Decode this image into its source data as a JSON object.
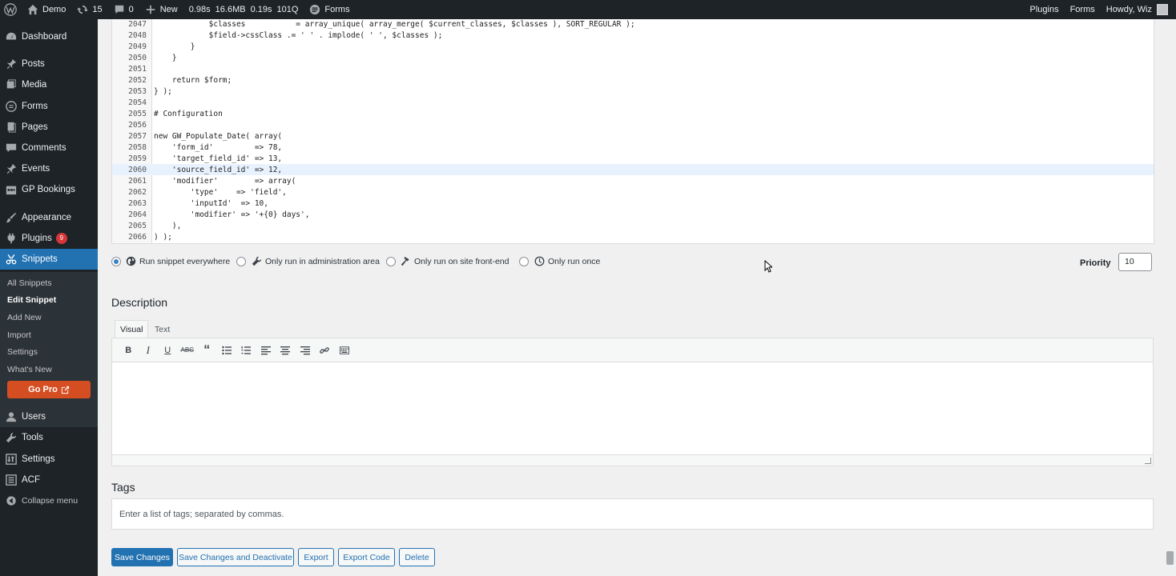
{
  "adminbar": {
    "site_name": "Demo",
    "updates": "15",
    "comments": "0",
    "new_label": "New",
    "stat_time": "0.98s",
    "stat_mem": "16.6MB",
    "stat_query_time": "0.19s",
    "stat_queries": "101Q",
    "forms": "Forms",
    "right_plugins": "Plugins",
    "right_forms": "Forms",
    "howdy": "Howdy, Wiz"
  },
  "sidebar": {
    "items": [
      {
        "label": "Dashboard",
        "icon": "dashboard-icon"
      },
      {
        "label": "Posts",
        "icon": "pin-icon"
      },
      {
        "label": "Media",
        "icon": "media-icon"
      },
      {
        "label": "Forms",
        "icon": "forms-icon"
      },
      {
        "label": "Pages",
        "icon": "pages-icon"
      },
      {
        "label": "Comments",
        "icon": "comments-icon"
      },
      {
        "label": "Events",
        "icon": "pin-icon"
      },
      {
        "label": "GP Bookings",
        "icon": "calendar-icon"
      },
      {
        "label": "Appearance",
        "icon": "brush-icon"
      },
      {
        "label": "Plugins",
        "icon": "plugin-icon",
        "badge": "9"
      },
      {
        "label": "Snippets",
        "icon": "scissors-icon"
      },
      {
        "label": "Users",
        "icon": "users-icon"
      },
      {
        "label": "Tools",
        "icon": "wrench-icon"
      },
      {
        "label": "Settings",
        "icon": "settings-icon"
      },
      {
        "label": "ACF",
        "icon": "acf-icon"
      },
      {
        "label": "Collapse menu",
        "icon": "collapse-icon"
      }
    ],
    "submenu": [
      "All Snippets",
      "Edit Snippet",
      "Add New",
      "Import",
      "Settings",
      "What's New"
    ],
    "go_pro": "Go Pro"
  },
  "code": {
    "lines": [
      {
        "n": "2047",
        "t": "            $classes           = array_unique( array_merge( $current_classes, $classes ), SORT_REGULAR );"
      },
      {
        "n": "2048",
        "t": "            $field->cssClass .= ' ' . implode( ' ', $classes );"
      },
      {
        "n": "2049",
        "t": "        }"
      },
      {
        "n": "2050",
        "t": "    }"
      },
      {
        "n": "2051",
        "t": ""
      },
      {
        "n": "2052",
        "t": "    return $form;"
      },
      {
        "n": "2053",
        "t": "} );"
      },
      {
        "n": "2054",
        "t": ""
      },
      {
        "n": "2055",
        "t": "# Configuration"
      },
      {
        "n": "2056",
        "t": ""
      },
      {
        "n": "2057",
        "t": "new GW_Populate_Date( array("
      },
      {
        "n": "2058",
        "t": "    'form_id'         => 78,"
      },
      {
        "n": "2059",
        "t": "    'target_field_id' => 13,"
      },
      {
        "n": "2060",
        "t": "    'source_field_id' => 12,"
      },
      {
        "n": "2061",
        "t": "    'modifier'        => array("
      },
      {
        "n": "2062",
        "t": "        'type'    => 'field',"
      },
      {
        "n": "2063",
        "t": "        'inputId'  => 10,"
      },
      {
        "n": "2064",
        "t": "        'modifier' => '+{0} days',"
      },
      {
        "n": "2065",
        "t": "    ),"
      },
      {
        "n": "2066",
        "t": ") );"
      }
    ],
    "active_line": "2060"
  },
  "run_options": {
    "everywhere": "Run snippet everywhere",
    "admin": "Only run in administration area",
    "frontend": "Only run on site front-end",
    "once": "Only run once",
    "selected": "everywhere"
  },
  "priority": {
    "label": "Priority",
    "value": "10"
  },
  "description": {
    "heading": "Description",
    "tab_visual": "Visual",
    "tab_text": "Text",
    "toolbar": [
      "bold-icon",
      "italic-icon",
      "underline-icon",
      "strikethrough-icon",
      "blockquote-icon",
      "bullet-list-icon",
      "numbered-list-icon",
      "align-left-icon",
      "align-center-icon",
      "align-right-icon",
      "link-icon",
      "toolbar-toggle-icon"
    ]
  },
  "tags": {
    "heading": "Tags",
    "placeholder": "Enter a list of tags; separated by commas."
  },
  "actions": {
    "save": "Save Changes",
    "save_deactivate": "Save Changes and Deactivate",
    "export": "Export",
    "export_code": "Export Code",
    "delete": "Delete"
  },
  "colors": {
    "primary": "#2271b1",
    "adminbar": "#1d2327",
    "go_pro": "#d54e21",
    "badge": "#d63638"
  }
}
